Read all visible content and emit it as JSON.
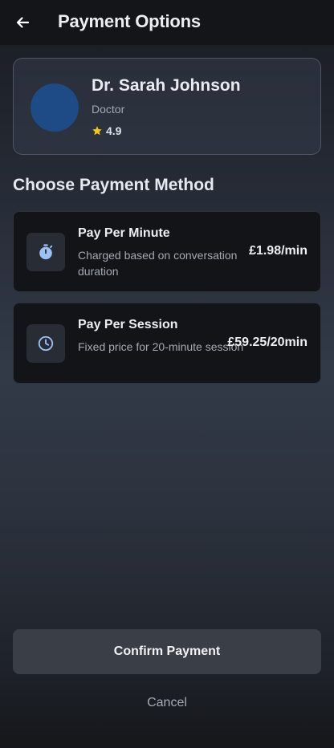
{
  "header": {
    "title": "Payment Options",
    "back_icon": "arrow-left-icon"
  },
  "doctor": {
    "name": "Dr. Sarah Johnson",
    "role": "Doctor",
    "rating": "4.9",
    "rating_icon": "star-icon",
    "avatar_color": "#1e4a86"
  },
  "section_title": "Choose Payment Method",
  "options": [
    {
      "title": "Pay Per Minute",
      "description": "Charged based on conversation duration",
      "price": "£1.98/min",
      "icon": "stopwatch-icon"
    },
    {
      "title": "Pay Per Session",
      "description": "Fixed price for 20-minute session",
      "price": "£59.25/20min",
      "icon": "clock-icon"
    }
  ],
  "actions": {
    "confirm_label": "Confirm Payment",
    "cancel_label": "Cancel"
  },
  "colors": {
    "accent_icon": "#9cc2f5",
    "star": "#f5c518",
    "card_border": "#4b5567"
  }
}
